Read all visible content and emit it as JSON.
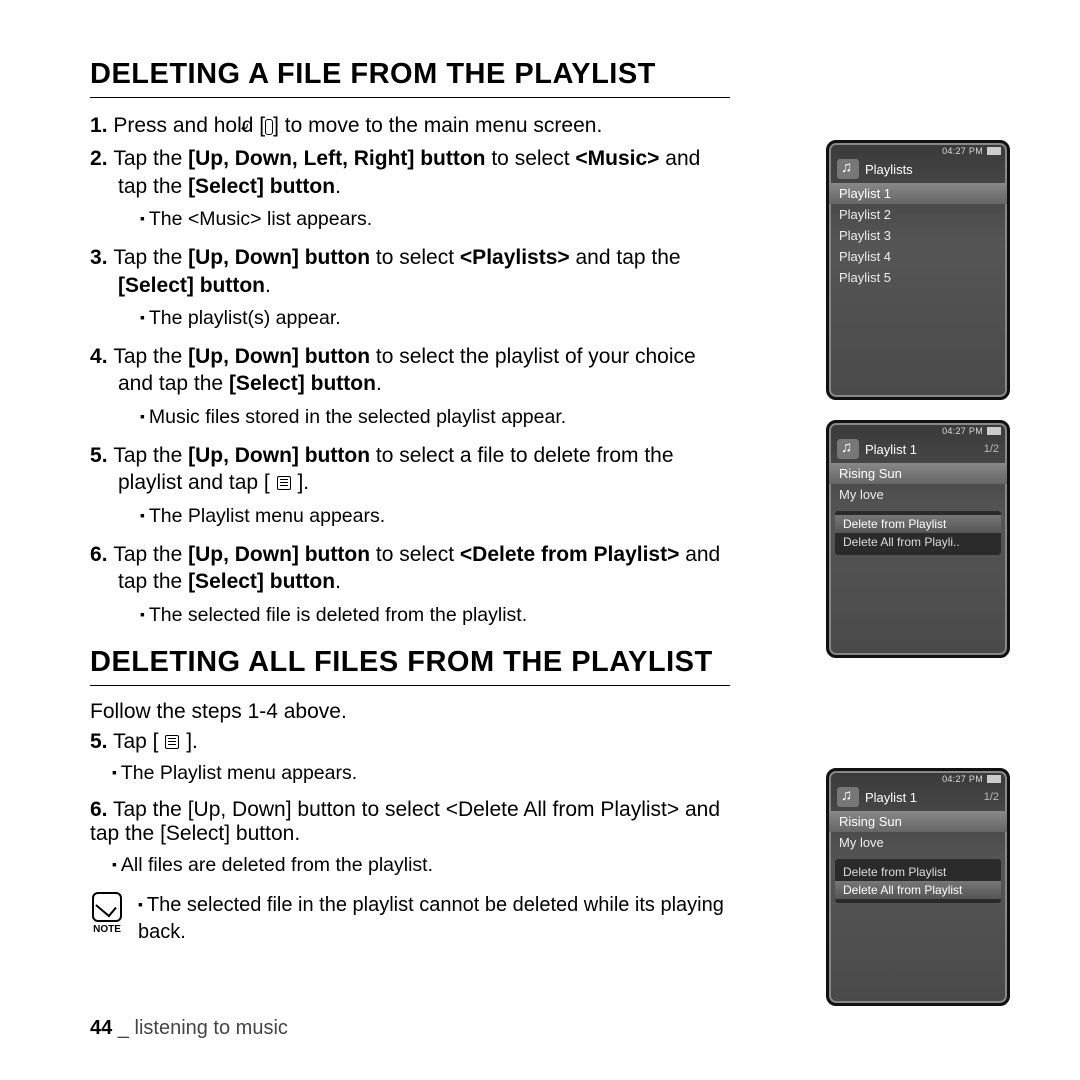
{
  "section1_title": "DELETING A FILE FROM THE PLAYLIST",
  "section2_title": "DELETING ALL FILES FROM THE PLAYLIST",
  "steps1": {
    "s1_a": "Press and hold [",
    "s1_b": "] to move to the main menu screen.",
    "s2_a": "Tap the ",
    "s2_b": "[Up, Down, Left, Right] button",
    "s2_c": " to select ",
    "s2_d": "<Music>",
    "s2_e": " and tap the ",
    "s2_f": "[Select] button",
    "s2_g": ".",
    "s2_sub": "The <Music> list appears.",
    "s3_a": "Tap the ",
    "s3_b": "[Up, Down] button",
    "s3_c": " to select ",
    "s3_d": "<Playlists>",
    "s3_e": " and tap the ",
    "s3_f": "[Select] button",
    "s3_g": ".",
    "s3_sub": "The playlist(s) appear.",
    "s4_a": "Tap the ",
    "s4_b": "[Up, Down] button",
    "s4_c": " to select the playlist of your choice and tap the ",
    "s4_d": "[Select] button",
    "s4_e": ".",
    "s4_sub": "Music files stored in the selected playlist appear.",
    "s5_a": "Tap the ",
    "s5_b": "[Up, Down] button",
    "s5_c": " to select a file to delete from the playlist and tap [",
    "s5_d": "].",
    "s5_sub": "The Playlist menu appears.",
    "s6_a": "Tap the ",
    "s6_b": "[Up, Down] button",
    "s6_c": " to select ",
    "s6_d": "<Delete from Playlist>",
    "s6_e": " and tap the ",
    "s6_f": "[Select] button",
    "s6_g": ".",
    "s6_sub": "The selected file is deleted from the playlist."
  },
  "steps2": {
    "intro": "Follow the steps 1-4 above.",
    "s5_num": "5.",
    "s5_a": " Tap ",
    "s5_b": "[",
    "s5_c": "]",
    "s5_d": ".",
    "s5_sub": "The Playlist menu appears.",
    "s6_num": "6.",
    "s6_a": " Tap the ",
    "s6_b": "[Up, Down] button",
    "s6_c": " to select ",
    "s6_d": "<Delete All from Playlist>",
    "s6_e": " and tap the ",
    "s6_f": "[Select] button",
    "s6_g": ".",
    "s6_sub": "All files are deleted from the playlist."
  },
  "note_label": "NOTE",
  "note_text": "The selected file in the playlist cannot be deleted while its playing back.",
  "footer_page": "44",
  "footer_sep": " _ ",
  "footer_text": "listening to music",
  "device": {
    "time": "04:27 PM",
    "playlists_title": "Playlists",
    "playlists": [
      "Playlist 1",
      "Playlist 2",
      "Playlist 3",
      "Playlist 4",
      "Playlist 5"
    ],
    "playlist1_title": "Playlist 1",
    "playlist1_count": "1/2",
    "songs": [
      "Rising Sun",
      "My love"
    ],
    "menu_delete": "Delete from Playlist",
    "menu_delete_all_trunc": "Delete All from Playli..",
    "menu_delete_all": "Delete All from Playlist"
  }
}
